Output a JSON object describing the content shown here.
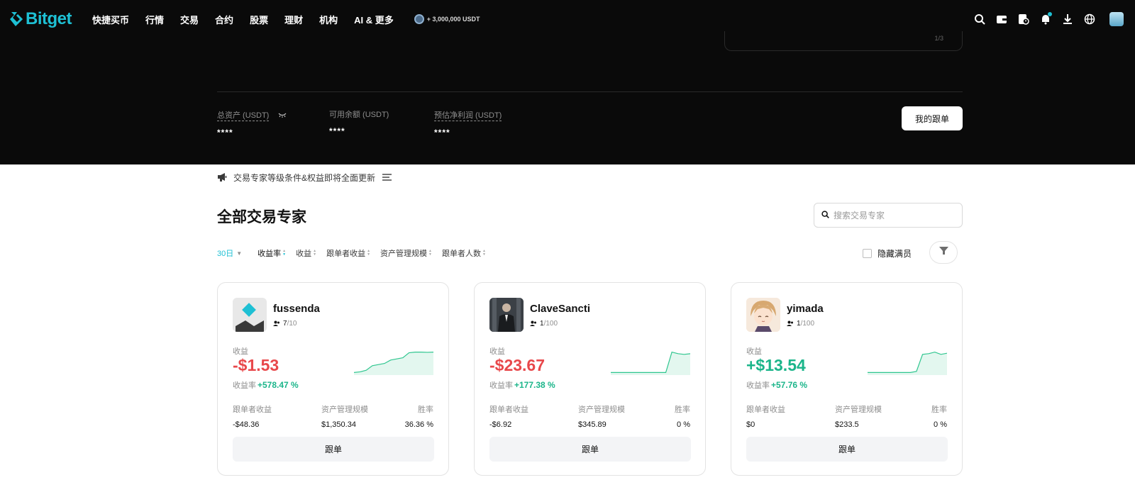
{
  "brand": {
    "name": "Bitget",
    "accent": "#1ec0d4"
  },
  "nav": {
    "items": [
      "快捷买币",
      "行情",
      "交易",
      "合约",
      "股票",
      "理财",
      "机构",
      "AI & 更多"
    ],
    "promo": "+ 3,000,000 USDT",
    "icons": [
      "search-icon",
      "wallet-icon",
      "orders-icon",
      "bell-icon",
      "download-icon",
      "globe-icon",
      "avatar"
    ]
  },
  "hero": {
    "card_mark": "1/3",
    "stats": [
      {
        "label": "总资产 (USDT)",
        "value": "****"
      },
      {
        "label": "可用余额 (USDT)",
        "value": "****"
      },
      {
        "label": "预估净利润 (USDT)",
        "value": "****"
      }
    ],
    "my_copy_button": "我的跟单"
  },
  "announcement": "交易专家等级条件&权益即将全面更新",
  "section": {
    "title": "全部交易专家",
    "search_placeholder": "搜索交易专家"
  },
  "filters": {
    "period": "30日",
    "sorts": [
      "收益率",
      "收益",
      "跟单者收益",
      "资产管理规模",
      "跟单者人数"
    ],
    "active_sort": "收益率",
    "hide_full_label": "隐藏满员"
  },
  "labels": {
    "pnl": "收益",
    "roi": "收益率",
    "follower_pnl": "跟单者收益",
    "aum": "资产管理规模",
    "win_rate": "胜率",
    "copy": "跟单"
  },
  "traders": [
    {
      "name": "fussenda",
      "followers": "7",
      "max_followers": "/10",
      "pnl": "-$1.53",
      "pnl_sign": "negative",
      "roi": "+578.47 %",
      "follower_pnl": "-$48.36",
      "aum": "$1,350.34",
      "win_rate": "36.36 %",
      "spark": [
        0.05,
        0.08,
        0.15,
        0.35,
        0.4,
        0.45,
        0.6,
        0.65,
        0.7,
        0.92,
        0.95,
        0.95,
        0.94,
        0.95
      ]
    },
    {
      "name": "ClaveSancti",
      "followers": "1",
      "max_followers": "/100",
      "pnl": "-$23.67",
      "pnl_sign": "negative",
      "roi": "+177.38 %",
      "follower_pnl": "-$6.92",
      "aum": "$345.89",
      "win_rate": "0 %",
      "spark": [
        0.05,
        0.05,
        0.05,
        0.05,
        0.05,
        0.05,
        0.05,
        0.05,
        0.05,
        0.05,
        0.95,
        0.88,
        0.85,
        0.88
      ]
    },
    {
      "name": "yimada",
      "followers": "1",
      "max_followers": "/100",
      "pnl": "+$13.54",
      "pnl_sign": "positive",
      "roi": "+57.76 %",
      "follower_pnl": "$0",
      "aum": "$233.5",
      "win_rate": "0 %",
      "spark": [
        0.05,
        0.05,
        0.05,
        0.05,
        0.05,
        0.05,
        0.05,
        0.05,
        0.1,
        0.85,
        0.88,
        0.95,
        0.85,
        0.9
      ]
    }
  ]
}
